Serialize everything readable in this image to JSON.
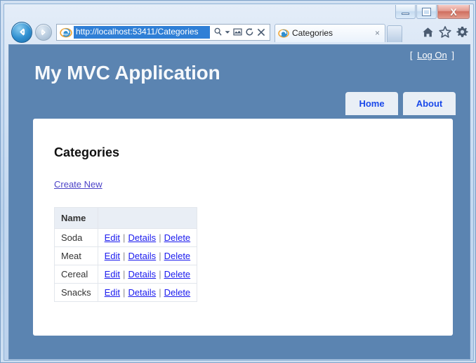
{
  "window": {
    "minimize_label": "Minimize",
    "maximize_label": "Maximize",
    "close_label": "X"
  },
  "browser": {
    "back_label": "Back",
    "forward_label": "Forward",
    "address": {
      "url": "http://localhost:53411/Categories",
      "placeholder": "http://localhost:53411/Categories",
      "search_icon": "search-icon",
      "dropdown_icon": "chevron-down-icon",
      "compatibility_icon": "compatibility-view-icon",
      "refresh_icon": "refresh-icon",
      "stop_icon": "stop-icon"
    },
    "tab": {
      "title": "Categories",
      "close_label": "×",
      "favicon": "ie-icon"
    },
    "new_tab_label": "",
    "commands": {
      "home_icon": "home-icon",
      "favorites_icon": "star-icon",
      "tools_icon": "gear-icon"
    }
  },
  "page": {
    "site_title": "My MVC Application",
    "logon_bracket_open": "[",
    "logon_label": "Log On",
    "logon_bracket_close": "]",
    "nav": [
      {
        "label": "Home"
      },
      {
        "label": "About"
      }
    ],
    "content": {
      "heading": "Categories",
      "create_new_label": "Create New",
      "table": {
        "columns": [
          "Name",
          ""
        ],
        "action_labels": {
          "edit": "Edit",
          "details": "Details",
          "delete": "Delete",
          "separator": "|"
        },
        "rows": [
          {
            "name": "Soda"
          },
          {
            "name": "Meat"
          },
          {
            "name": "Cereal"
          },
          {
            "name": "Snacks"
          }
        ]
      }
    }
  },
  "colors": {
    "page_background": "#5b84b1",
    "card_background": "#ffffff",
    "link_blue": "#1a1aee",
    "visited_purple": "#4c43c7",
    "nav_tab_text": "#1a49ea",
    "table_header_bg": "#e9eef5"
  }
}
